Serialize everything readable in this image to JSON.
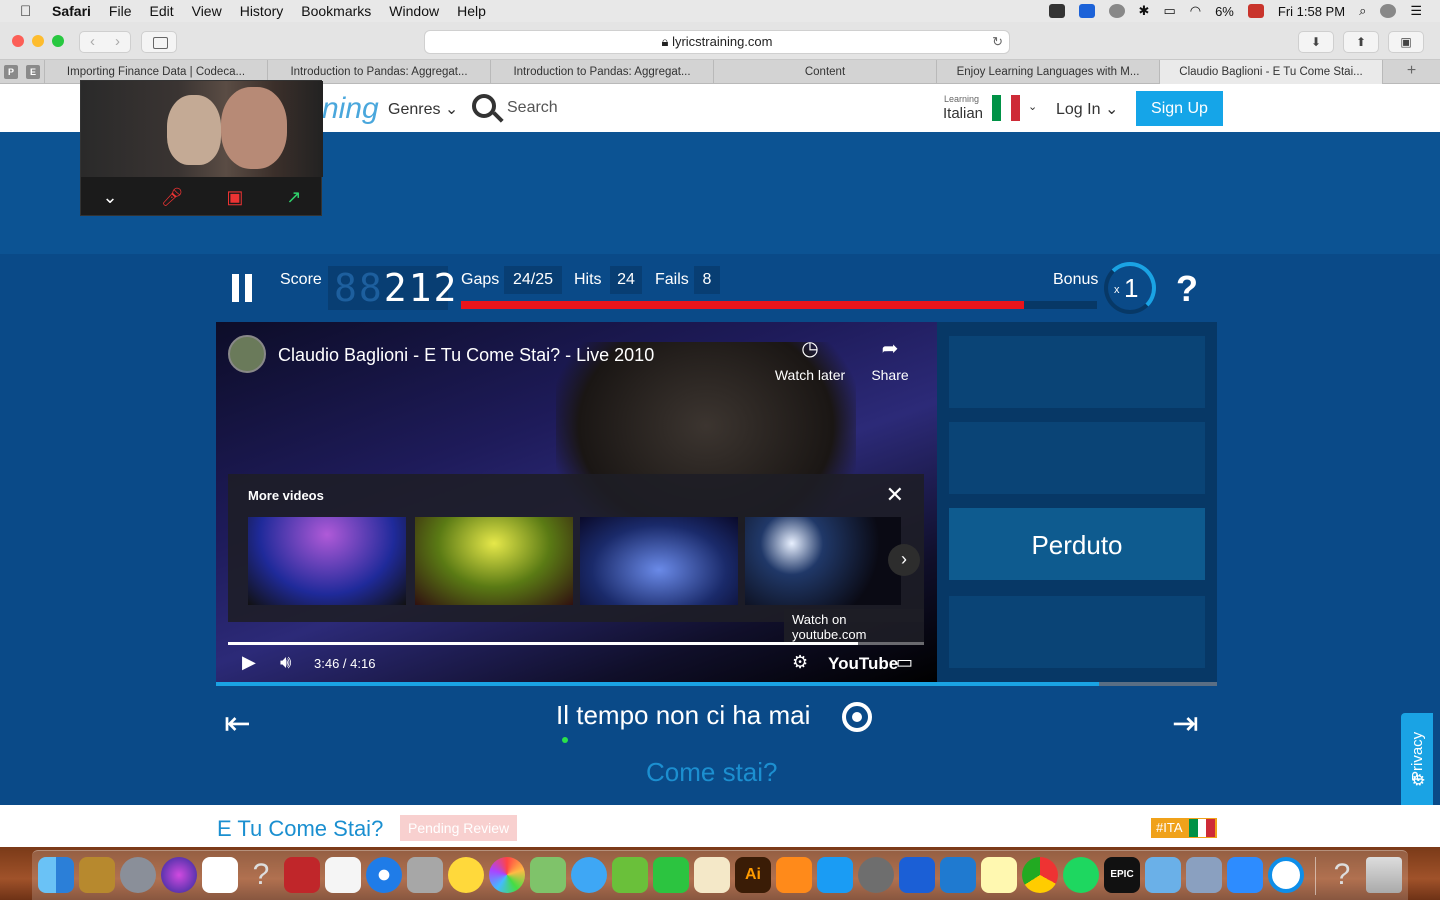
{
  "menubar": {
    "app": "Safari",
    "items": [
      "File",
      "Edit",
      "View",
      "History",
      "Bookmarks",
      "Window",
      "Help"
    ],
    "battery": "6%",
    "clock": "Fri 1:58 PM"
  },
  "browser": {
    "url": "lyricstraining.com",
    "pinned": [
      "P",
      "E"
    ],
    "tabs": [
      "Importing Finance Data | Codeca...",
      "Introduction to Pandas: Aggregat...",
      "Introduction to Pandas: Aggregat...",
      "Content",
      "Enjoy Learning Languages with M...",
      "Claudio Baglioni - E Tu Come Stai..."
    ]
  },
  "header": {
    "logo_fragment": "ning",
    "genres_label": "Genres",
    "search_label": "Search",
    "learning_small": "Learning",
    "learning_language": "Italian",
    "login_label": "Log In",
    "signup_label": "Sign Up"
  },
  "game": {
    "score_label": "Score",
    "score_ghost": "88",
    "score_value": "212",
    "gaps_label": "Gaps",
    "gaps_value": "24/25",
    "hits_label": "Hits",
    "hits_value": "24",
    "fails_label": "Fails",
    "fails_value": "8",
    "progress_fraction": 0.885,
    "bonus_label": "Bonus",
    "bonus_prefix": "x",
    "bonus_value": "1",
    "help_label": "?"
  },
  "video": {
    "title": "Claudio Baglioni - E Tu Come Stai? - Live 2010",
    "watch_later": "Watch later",
    "share": "Share",
    "more_videos": "More videos",
    "watch_on": "Watch on youtube.com",
    "time": "3:46 / 4:16",
    "played_fraction": 0.905,
    "brand": "YouTube"
  },
  "answers": {
    "chosen": "Perduto"
  },
  "line_progress_fraction": 0.882,
  "lyrics": {
    "current": "Il tempo non ci ha mai",
    "next": "Come stai?"
  },
  "privacy_label": "Privacy",
  "song": {
    "title": "E Tu Come Stai?",
    "status": "Pending Review",
    "tag": "#ITA"
  },
  "colors": {
    "accent": "#1aa3e4",
    "progress_red": "#e8141b",
    "flag_green": "#009246",
    "flag_white": "#ffffff",
    "flag_red": "#ce2b37"
  }
}
